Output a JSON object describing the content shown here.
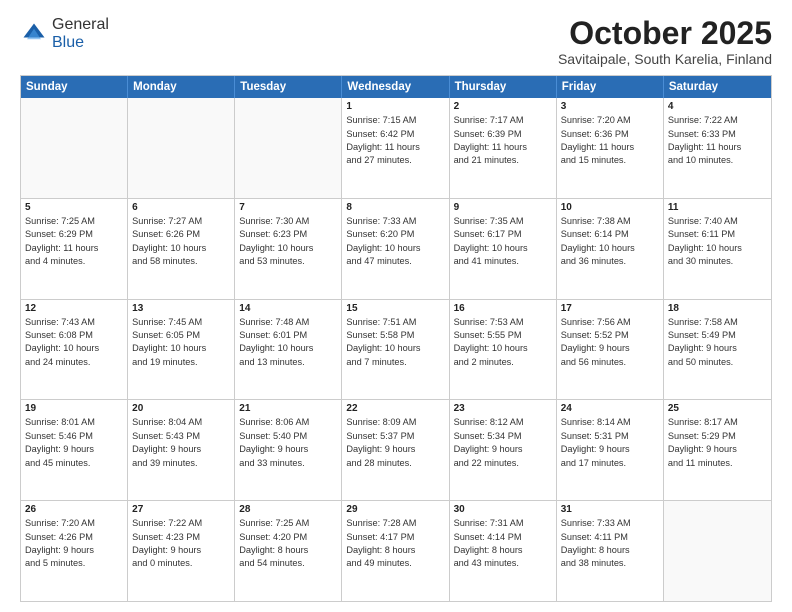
{
  "header": {
    "logo_general": "General",
    "logo_blue": "Blue",
    "month_title": "October 2025",
    "location": "Savitaipale, South Karelia, Finland"
  },
  "weekdays": [
    "Sunday",
    "Monday",
    "Tuesday",
    "Wednesday",
    "Thursday",
    "Friday",
    "Saturday"
  ],
  "rows": [
    [
      {
        "day": "",
        "empty": true
      },
      {
        "day": "",
        "empty": true
      },
      {
        "day": "",
        "empty": true
      },
      {
        "day": "1",
        "lines": [
          "Sunrise: 7:15 AM",
          "Sunset: 6:42 PM",
          "Daylight: 11 hours",
          "and 27 minutes."
        ]
      },
      {
        "day": "2",
        "lines": [
          "Sunrise: 7:17 AM",
          "Sunset: 6:39 PM",
          "Daylight: 11 hours",
          "and 21 minutes."
        ]
      },
      {
        "day": "3",
        "lines": [
          "Sunrise: 7:20 AM",
          "Sunset: 6:36 PM",
          "Daylight: 11 hours",
          "and 15 minutes."
        ]
      },
      {
        "day": "4",
        "lines": [
          "Sunrise: 7:22 AM",
          "Sunset: 6:33 PM",
          "Daylight: 11 hours",
          "and 10 minutes."
        ]
      }
    ],
    [
      {
        "day": "5",
        "lines": [
          "Sunrise: 7:25 AM",
          "Sunset: 6:29 PM",
          "Daylight: 11 hours",
          "and 4 minutes."
        ]
      },
      {
        "day": "6",
        "lines": [
          "Sunrise: 7:27 AM",
          "Sunset: 6:26 PM",
          "Daylight: 10 hours",
          "and 58 minutes."
        ]
      },
      {
        "day": "7",
        "lines": [
          "Sunrise: 7:30 AM",
          "Sunset: 6:23 PM",
          "Daylight: 10 hours",
          "and 53 minutes."
        ]
      },
      {
        "day": "8",
        "lines": [
          "Sunrise: 7:33 AM",
          "Sunset: 6:20 PM",
          "Daylight: 10 hours",
          "and 47 minutes."
        ]
      },
      {
        "day": "9",
        "lines": [
          "Sunrise: 7:35 AM",
          "Sunset: 6:17 PM",
          "Daylight: 10 hours",
          "and 41 minutes."
        ]
      },
      {
        "day": "10",
        "lines": [
          "Sunrise: 7:38 AM",
          "Sunset: 6:14 PM",
          "Daylight: 10 hours",
          "and 36 minutes."
        ]
      },
      {
        "day": "11",
        "lines": [
          "Sunrise: 7:40 AM",
          "Sunset: 6:11 PM",
          "Daylight: 10 hours",
          "and 30 minutes."
        ]
      }
    ],
    [
      {
        "day": "12",
        "lines": [
          "Sunrise: 7:43 AM",
          "Sunset: 6:08 PM",
          "Daylight: 10 hours",
          "and 24 minutes."
        ]
      },
      {
        "day": "13",
        "lines": [
          "Sunrise: 7:45 AM",
          "Sunset: 6:05 PM",
          "Daylight: 10 hours",
          "and 19 minutes."
        ]
      },
      {
        "day": "14",
        "lines": [
          "Sunrise: 7:48 AM",
          "Sunset: 6:01 PM",
          "Daylight: 10 hours",
          "and 13 minutes."
        ]
      },
      {
        "day": "15",
        "lines": [
          "Sunrise: 7:51 AM",
          "Sunset: 5:58 PM",
          "Daylight: 10 hours",
          "and 7 minutes."
        ]
      },
      {
        "day": "16",
        "lines": [
          "Sunrise: 7:53 AM",
          "Sunset: 5:55 PM",
          "Daylight: 10 hours",
          "and 2 minutes."
        ]
      },
      {
        "day": "17",
        "lines": [
          "Sunrise: 7:56 AM",
          "Sunset: 5:52 PM",
          "Daylight: 9 hours",
          "and 56 minutes."
        ]
      },
      {
        "day": "18",
        "lines": [
          "Sunrise: 7:58 AM",
          "Sunset: 5:49 PM",
          "Daylight: 9 hours",
          "and 50 minutes."
        ]
      }
    ],
    [
      {
        "day": "19",
        "lines": [
          "Sunrise: 8:01 AM",
          "Sunset: 5:46 PM",
          "Daylight: 9 hours",
          "and 45 minutes."
        ]
      },
      {
        "day": "20",
        "lines": [
          "Sunrise: 8:04 AM",
          "Sunset: 5:43 PM",
          "Daylight: 9 hours",
          "and 39 minutes."
        ]
      },
      {
        "day": "21",
        "lines": [
          "Sunrise: 8:06 AM",
          "Sunset: 5:40 PM",
          "Daylight: 9 hours",
          "and 33 minutes."
        ]
      },
      {
        "day": "22",
        "lines": [
          "Sunrise: 8:09 AM",
          "Sunset: 5:37 PM",
          "Daylight: 9 hours",
          "and 28 minutes."
        ]
      },
      {
        "day": "23",
        "lines": [
          "Sunrise: 8:12 AM",
          "Sunset: 5:34 PM",
          "Daylight: 9 hours",
          "and 22 minutes."
        ]
      },
      {
        "day": "24",
        "lines": [
          "Sunrise: 8:14 AM",
          "Sunset: 5:31 PM",
          "Daylight: 9 hours",
          "and 17 minutes."
        ]
      },
      {
        "day": "25",
        "lines": [
          "Sunrise: 8:17 AM",
          "Sunset: 5:29 PM",
          "Daylight: 9 hours",
          "and 11 minutes."
        ]
      }
    ],
    [
      {
        "day": "26",
        "lines": [
          "Sunrise: 7:20 AM",
          "Sunset: 4:26 PM",
          "Daylight: 9 hours",
          "and 5 minutes."
        ]
      },
      {
        "day": "27",
        "lines": [
          "Sunrise: 7:22 AM",
          "Sunset: 4:23 PM",
          "Daylight: 9 hours",
          "and 0 minutes."
        ]
      },
      {
        "day": "28",
        "lines": [
          "Sunrise: 7:25 AM",
          "Sunset: 4:20 PM",
          "Daylight: 8 hours",
          "and 54 minutes."
        ]
      },
      {
        "day": "29",
        "lines": [
          "Sunrise: 7:28 AM",
          "Sunset: 4:17 PM",
          "Daylight: 8 hours",
          "and 49 minutes."
        ]
      },
      {
        "day": "30",
        "lines": [
          "Sunrise: 7:31 AM",
          "Sunset: 4:14 PM",
          "Daylight: 8 hours",
          "and 43 minutes."
        ]
      },
      {
        "day": "31",
        "lines": [
          "Sunrise: 7:33 AM",
          "Sunset: 4:11 PM",
          "Daylight: 8 hours",
          "and 38 minutes."
        ]
      },
      {
        "day": "",
        "empty": true
      }
    ]
  ]
}
